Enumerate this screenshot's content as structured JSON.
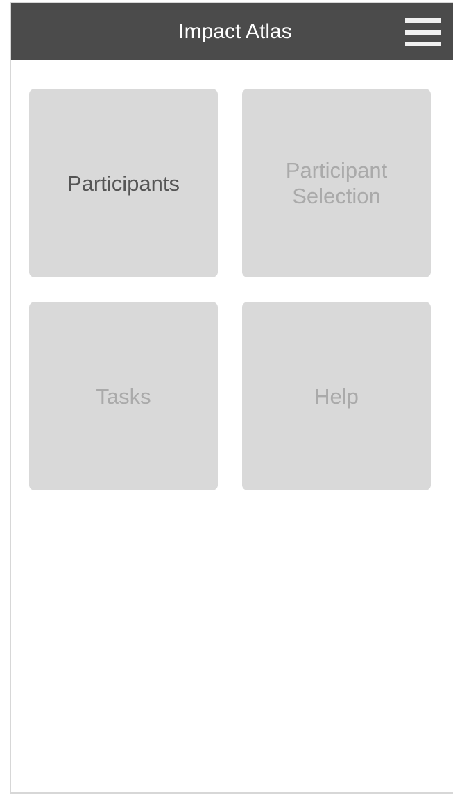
{
  "header": {
    "title": "Impact Atlas",
    "menu_icon": "hamburger-menu-icon"
  },
  "tiles": [
    {
      "label": "Participants",
      "state": "enabled"
    },
    {
      "label": "Participant\nSelection",
      "state": "disabled"
    },
    {
      "label": "Tasks",
      "state": "disabled"
    },
    {
      "label": "Help",
      "state": "disabled"
    }
  ],
  "colors": {
    "header_bg": "#4b4b4b",
    "tile_bg": "#d9d9d9",
    "active_text": "#555555",
    "inactive_text": "#aaaaaa"
  }
}
